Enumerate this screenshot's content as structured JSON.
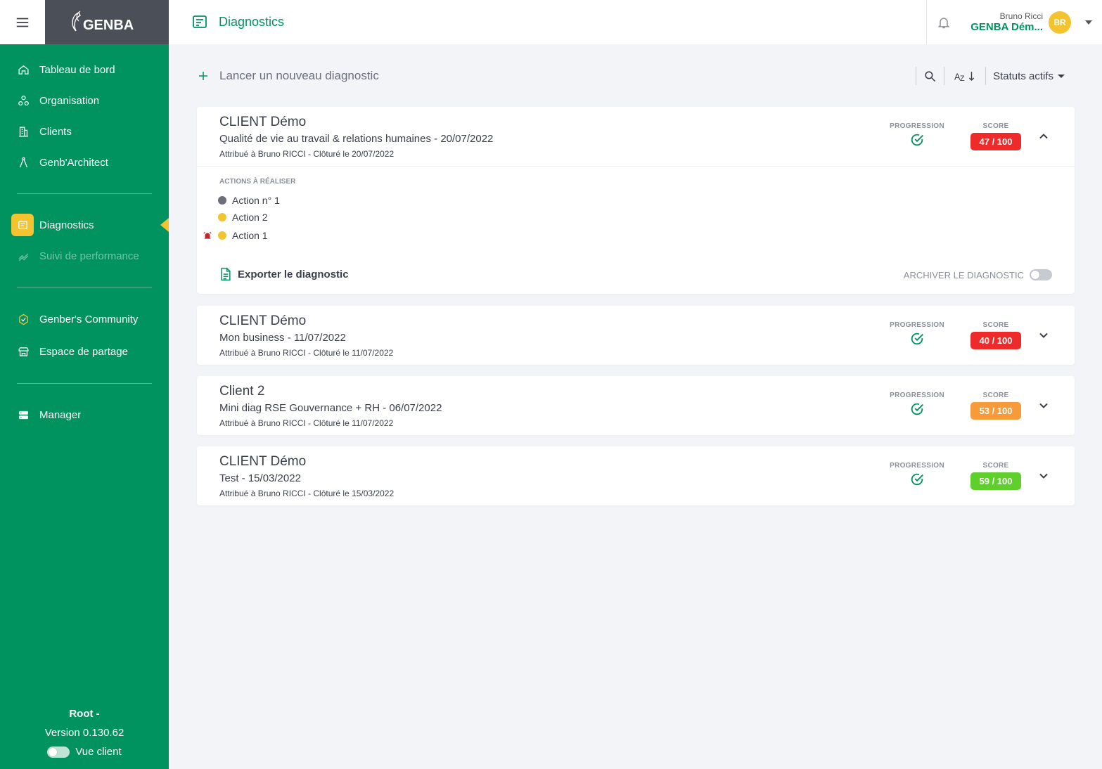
{
  "app": {
    "brand": "GENBA"
  },
  "sidebar": {
    "items": [
      {
        "label": "Tableau de bord",
        "icon": "home-icon"
      },
      {
        "label": "Organisation",
        "icon": "organisation-icon"
      },
      {
        "label": "Clients",
        "icon": "building-icon"
      },
      {
        "label": "Genb'Architect",
        "icon": "compass-icon"
      },
      {
        "label": "Diagnostics",
        "icon": "report-icon",
        "active": true
      },
      {
        "label": "Suivi de performance",
        "icon": "trend-icon",
        "disabled": true
      },
      {
        "label": "Genber's Community",
        "icon": "community-icon"
      },
      {
        "label": "Espace de partage",
        "icon": "store-icon"
      },
      {
        "label": "Manager",
        "icon": "server-icon"
      }
    ],
    "footer": {
      "root": "Root -",
      "version": "Version 0.130.62",
      "vue_client": "Vue client"
    }
  },
  "header": {
    "title": "Diagnostics",
    "user_name": "Bruno Ricci",
    "org": "GENBA Dém...",
    "avatar_initials": "BR"
  },
  "toolbar": {
    "new_label": "Lancer un nouveau diagnostic",
    "status_filter": "Statuts actifs"
  },
  "labels": {
    "progression": "PROGRESSION",
    "score": "SCORE",
    "actions": "ACTIONS À RÉALISER",
    "export": "Exporter le diagnostic",
    "archive": "ARCHIVER LE DIAGNOSTIC"
  },
  "colors": {
    "primary": "#00935f",
    "accent": "#f4c430",
    "score_red": "#ee2a2a",
    "score_orange": "#f79a3a",
    "score_green": "#5ecf2b"
  },
  "diagnostics": [
    {
      "client": "CLIENT Démo",
      "title": "Qualité de vie au travail & relations humaines - 20/07/2022",
      "meta": "Attribué à Bruno RICCI - Clôturé le 20/07/2022",
      "score": "47 / 100",
      "score_value": 47,
      "score_color": "#ee2a2a",
      "progress_complete": true,
      "expanded": true,
      "actions": [
        {
          "label": "Action n° 1",
          "color": "#6b6f7b",
          "alarm": false
        },
        {
          "label": "Action 2",
          "color": "#f4c430",
          "alarm": false
        },
        {
          "label": "Action 1",
          "color": "#f4c430",
          "alarm": true
        }
      ]
    },
    {
      "client": "CLIENT Démo",
      "title": "Mon business - 11/07/2022",
      "meta": "Attribué à Bruno RICCI - Clôturé le 11/07/2022",
      "score": "40 / 100",
      "score_value": 40,
      "score_color": "#ee2a2a",
      "progress_complete": true,
      "expanded": false
    },
    {
      "client": "Client 2",
      "title": "Mini diag RSE Gouvernance + RH - 06/07/2022",
      "meta": "Attribué à Bruno RICCI - Clôturé le 11/07/2022",
      "score": "53 / 100",
      "score_value": 53,
      "score_color": "#f79a3a",
      "progress_complete": true,
      "expanded": false
    },
    {
      "client": "CLIENT Démo",
      "title": "Test - 15/03/2022",
      "meta": "Attribué à Bruno RICCI - Clôturé le 15/03/2022",
      "score": "59 / 100",
      "score_value": 59,
      "score_color": "#5ecf2b",
      "progress_complete": true,
      "expanded": false
    }
  ]
}
